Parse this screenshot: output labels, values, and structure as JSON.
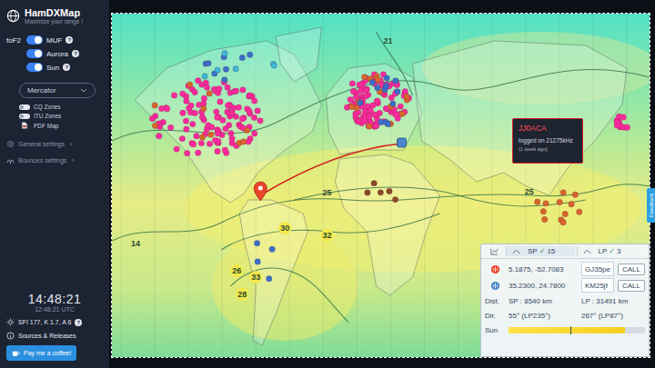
{
  "app": {
    "title": "HamDXMap",
    "subtitle": "Maximize your range !"
  },
  "layers": [
    {
      "prefix": "foF2",
      "label": "MUF",
      "on": true,
      "help": "?"
    },
    {
      "prefix": "",
      "label": "Aurora",
      "on": true,
      "help": "?"
    },
    {
      "prefix": "",
      "label": "Sun",
      "on": true,
      "help": "?"
    }
  ],
  "projection": {
    "value": "Mercator"
  },
  "overlays": [
    {
      "label": "CQ Zones",
      "kind": "toggle",
      "on": false
    },
    {
      "label": "ITU Zones",
      "kind": "toggle",
      "on": false
    },
    {
      "label": "PDF Map",
      "kind": "pdf",
      "on": false
    }
  ],
  "menu": [
    {
      "label": "General settings",
      "chevron": "›"
    },
    {
      "label": "Bounces settings",
      "chevron": "›"
    }
  ],
  "clock": {
    "local": "14:48:21",
    "utc": "12:48:21 UTC"
  },
  "solar": {
    "text": "SFI 177, K 1.7, A 6",
    "help": "?"
  },
  "sources": "Sources & Releases",
  "coffee": "Pay me a coffee!",
  "feedback": "Feedback",
  "map": {
    "contours": [
      {
        "text": "21",
        "kind": "plain"
      },
      {
        "text": "14",
        "kind": "plain"
      },
      {
        "text": "25",
        "kind": "plain"
      },
      {
        "text": "30",
        "kind": "badge"
      },
      {
        "text": "32",
        "kind": "badge"
      },
      {
        "text": "26",
        "kind": "badge"
      },
      {
        "text": "33",
        "kind": "badge"
      },
      {
        "text": "28",
        "kind": "badge"
      },
      {
        "text": "25",
        "kind": "plain"
      }
    ],
    "spots": [
      {
        "region": "north-america",
        "color": "#ff2a9d",
        "count": 110
      },
      {
        "region": "north-america",
        "color": "#d9662b",
        "count": 10
      },
      {
        "region": "canada",
        "color": "#3a6fc9",
        "count": 8
      },
      {
        "region": "canada",
        "color": "#3bb8d8",
        "count": 6
      },
      {
        "region": "europe",
        "color": "#ff2a9d",
        "count": 90
      },
      {
        "region": "europe",
        "color": "#d9662b",
        "count": 15
      },
      {
        "region": "europe",
        "color": "#3a6fc9",
        "count": 12
      },
      {
        "region": "japan",
        "color": "#ff2a9d",
        "count": 10
      },
      {
        "region": "se-asia",
        "color": "#d9662b",
        "count": 12
      },
      {
        "region": "south-america",
        "color": "#3a6fc9",
        "count": 4
      },
      {
        "region": "africa",
        "color": "#8a4a2a",
        "count": 5
      }
    ]
  },
  "popup": {
    "callsign": "JJ0ACA",
    "line": "logged on 21275kHz",
    "age": "(1 week ago)"
  },
  "panel": {
    "tabs": [
      {
        "label": "SP",
        "mark": "✓",
        "count": "15",
        "selected": true
      },
      {
        "label": "LP",
        "mark": "✓",
        "count": "3",
        "selected": false
      }
    ],
    "stations": [
      {
        "role": "tx",
        "coords": "5.1875, -52.7083",
        "grid": "GJ35pe",
        "action": "CALL"
      },
      {
        "role": "rx",
        "coords": "35.2300, 24.7800",
        "grid": "KM25jf",
        "action": "CALL"
      }
    ],
    "rows": [
      {
        "label": "Dist.",
        "sp": "SP : 8540 km",
        "lp": "LP : 31491 km"
      },
      {
        "label": "Dir.",
        "sp": "55° (LP235°)",
        "lp": "267° (LP87°)"
      }
    ],
    "sun": {
      "label": "Sun",
      "level": 0.85,
      "now": 0.45
    }
  }
}
